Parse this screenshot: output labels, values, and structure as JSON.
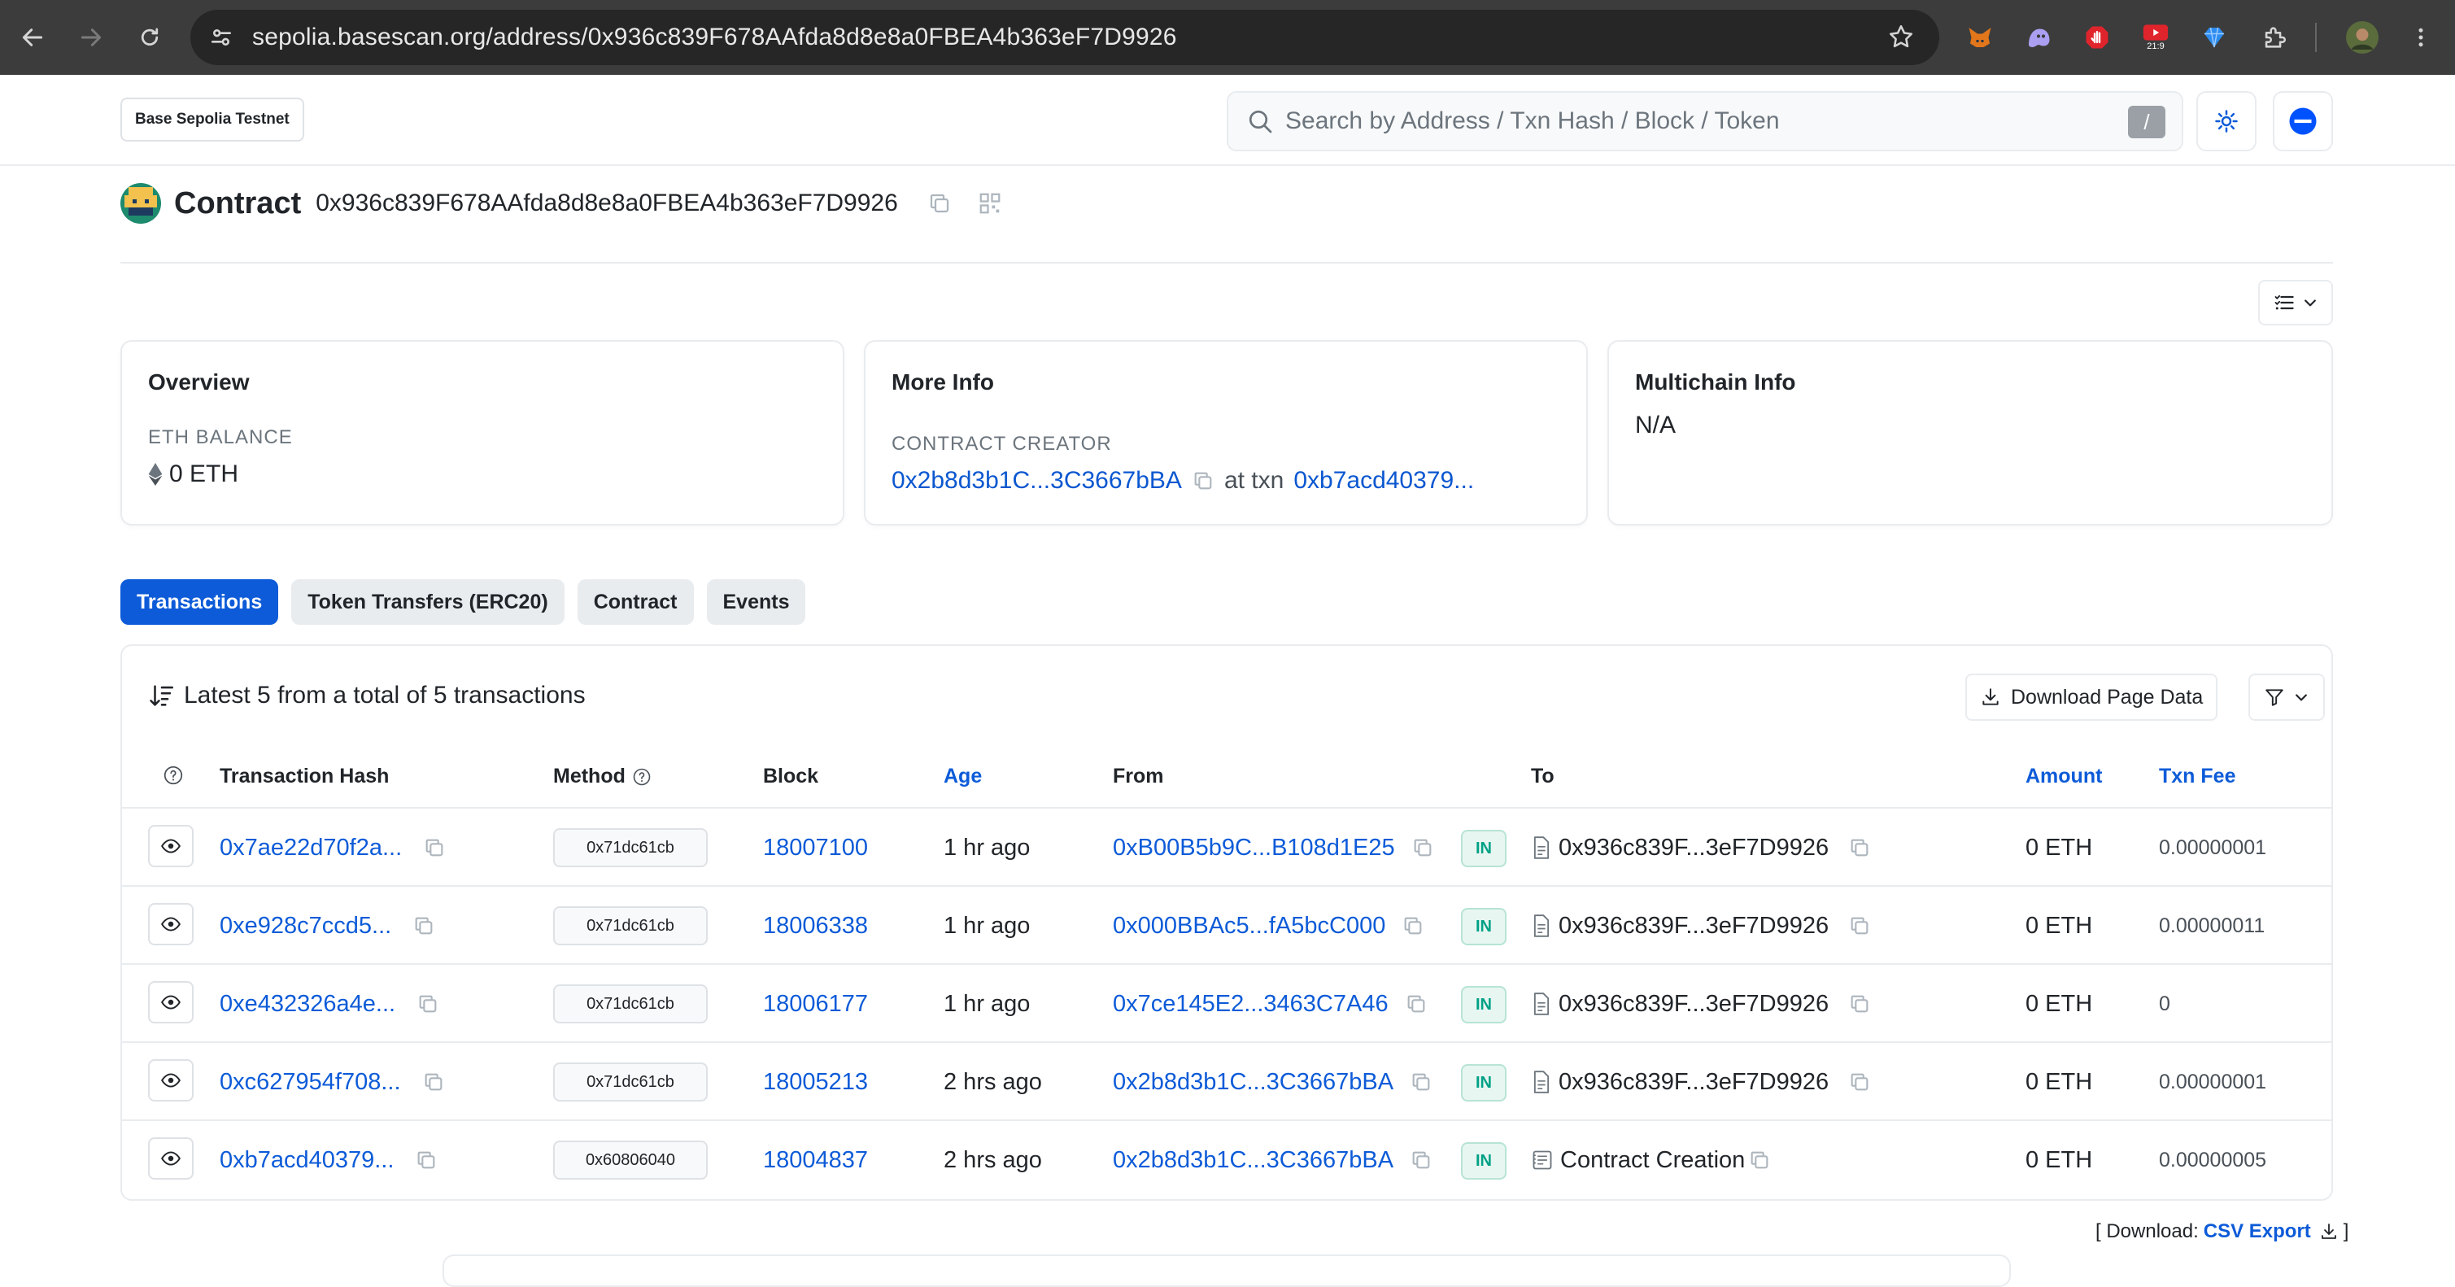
{
  "browser": {
    "url": "sepolia.basescan.org/address/0x936c839F678AAfda8d8e8a0FBEA4b363eF7D9926",
    "extension_badge": "21:9"
  },
  "header": {
    "network_badge": "Base Sepolia Testnet",
    "search_placeholder": "Search by Address / Txn Hash / Block / Token",
    "search_key": "/"
  },
  "title": {
    "label": "Contract",
    "address": "0x936c839F678AAfda8d8e8a0FBEA4b363eF7D9926"
  },
  "overview": {
    "title": "Overview",
    "balance_label": "ETH BALANCE",
    "balance_value": "0 ETH"
  },
  "more_info": {
    "title": "More Info",
    "creator_label": "CONTRACT CREATOR",
    "creator_address": "0x2b8d3b1C...3C3667bBA",
    "at_txn_text": "at txn",
    "creation_txn": "0xb7acd40379..."
  },
  "multichain": {
    "title": "Multichain Info",
    "value": "N/A"
  },
  "tabs": [
    {
      "label": "Transactions",
      "active": true
    },
    {
      "label": "Token Transfers (ERC20)",
      "active": false
    },
    {
      "label": "Contract",
      "active": false
    },
    {
      "label": "Events",
      "active": false
    }
  ],
  "transactions": {
    "summary": "Latest 5 from a total of 5 transactions",
    "download_label": "Download Page Data",
    "columns": {
      "hash": "Transaction Hash",
      "method": "Method",
      "block": "Block",
      "age": "Age",
      "from": "From",
      "to": "To",
      "amount": "Amount",
      "fee": "Txn Fee"
    },
    "rows": [
      {
        "hash": "0x7ae22d70f2a...",
        "method": "0x71dc61cb",
        "block": "18007100",
        "age": "1 hr ago",
        "from": "0xB00B5b9C...B108d1E25",
        "direction": "IN",
        "to": "0x936c839F...3eF7D9926",
        "to_icon": "contract-doc-icon",
        "amount": "0 ETH",
        "fee": "0.00000001"
      },
      {
        "hash": "0xe928c7ccd5...",
        "method": "0x71dc61cb",
        "block": "18006338",
        "age": "1 hr ago",
        "from": "0x000BBAc5...fA5bcC000",
        "direction": "IN",
        "to": "0x936c839F...3eF7D9926",
        "to_icon": "contract-doc-icon",
        "amount": "0 ETH",
        "fee": "0.00000011"
      },
      {
        "hash": "0xe432326a4e...",
        "method": "0x71dc61cb",
        "block": "18006177",
        "age": "1 hr ago",
        "from": "0x7ce145E2...3463C7A46",
        "direction": "IN",
        "to": "0x936c839F...3eF7D9926",
        "to_icon": "contract-doc-icon",
        "amount": "0 ETH",
        "fee": "0"
      },
      {
        "hash": "0xc627954f708...",
        "method": "0x71dc61cb",
        "block": "18005213",
        "age": "2 hrs ago",
        "from": "0x2b8d3b1C...3C3667bBA",
        "direction": "IN",
        "to": "0x936c839F...3eF7D9926",
        "to_icon": "contract-doc-icon",
        "amount": "0 ETH",
        "fee": "0.00000001"
      },
      {
        "hash": "0xb7acd40379...",
        "method": "0x60806040",
        "block": "18004837",
        "age": "2 hrs ago",
        "from": "0x2b8d3b1C...3C3667bBA",
        "direction": "IN",
        "to": "Contract Creation",
        "to_icon": "contract-creation-icon",
        "amount": "0 ETH",
        "fee": "0.00000005"
      }
    ]
  },
  "csv": {
    "prefix": "[ Download:",
    "link": "CSV Export",
    "suffix": "]"
  },
  "colors": {
    "accent": "#0d5bd8",
    "in_badge": "#00a186",
    "chrome_bg": "#3c3c3c"
  }
}
